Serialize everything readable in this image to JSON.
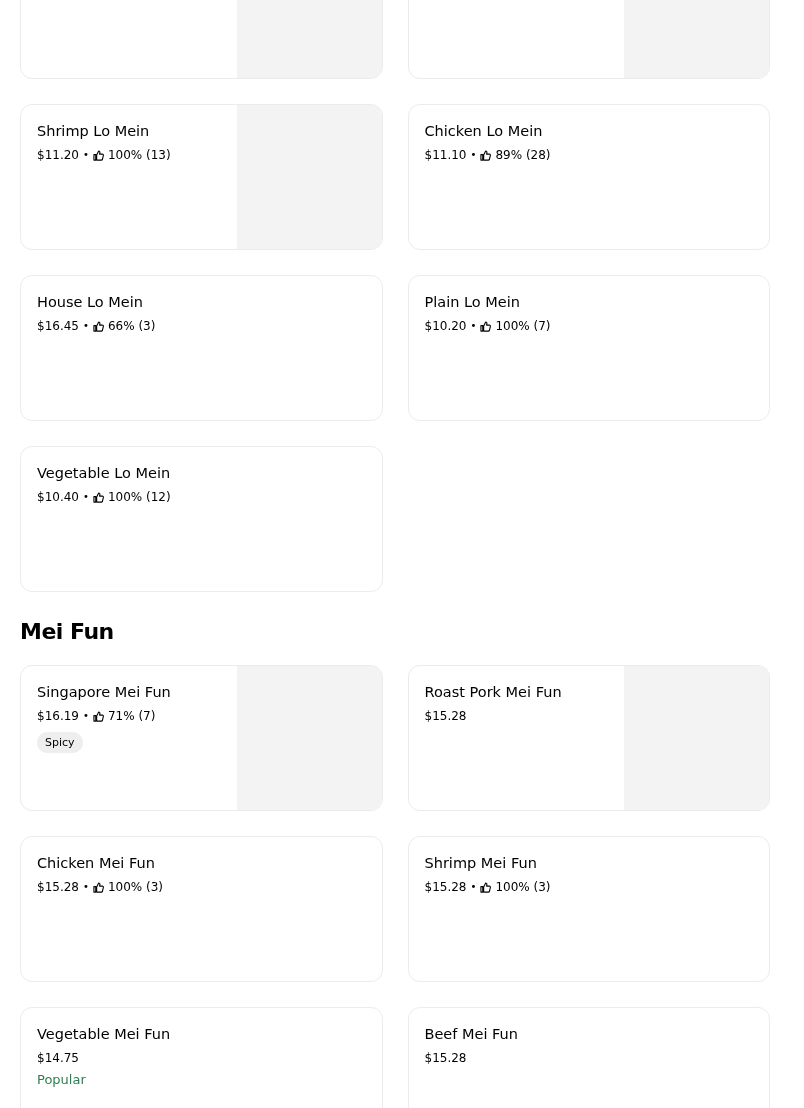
{
  "sections": [
    {
      "items": [
        {
          "has_image": true
        },
        {
          "has_image": true
        },
        {
          "name": "Shrimp Lo Mein",
          "price": "$11.20",
          "separator": "•",
          "rating": "100% (13)",
          "has_image": true
        },
        {
          "name": "Chicken Lo Mein",
          "price": "$11.10",
          "separator": "•",
          "rating": "89% (28)",
          "has_image": false
        },
        {
          "name": "House Lo Mein",
          "price": "$16.45",
          "separator": "•",
          "rating": "66% (3)",
          "has_image": false
        },
        {
          "name": "Plain Lo Mein",
          "price": "$10.20",
          "separator": "•",
          "rating": "100% (7)",
          "has_image": false
        },
        {
          "name": "Vegetable Lo Mein",
          "price": "$10.40",
          "separator": "•",
          "rating": "100% (12)",
          "has_image": false
        }
      ]
    },
    {
      "title": "Mei Fun",
      "items": [
        {
          "name": "Singapore Mei Fun",
          "price": "$16.19",
          "separator": "•",
          "rating": "71% (7)",
          "has_image": true,
          "badge": {
            "kind": "tag",
            "label": "Spicy"
          }
        },
        {
          "name": "Roast Pork Mei Fun",
          "price": "$15.28",
          "has_image": true
        },
        {
          "name": "Chicken Mei Fun",
          "price": "$15.28",
          "separator": "•",
          "rating": "100% (3)",
          "has_image": false
        },
        {
          "name": "Shrimp Mei Fun",
          "price": "$15.28",
          "separator": "•",
          "rating": "100% (3)",
          "has_image": false
        },
        {
          "name": "Vegetable Mei Fun",
          "price": "$14.75",
          "has_image": false,
          "badge": {
            "kind": "popular",
            "label": "Popular"
          }
        },
        {
          "name": "Beef Mei Fun",
          "price": "$15.28",
          "has_image": false
        }
      ]
    }
  ]
}
